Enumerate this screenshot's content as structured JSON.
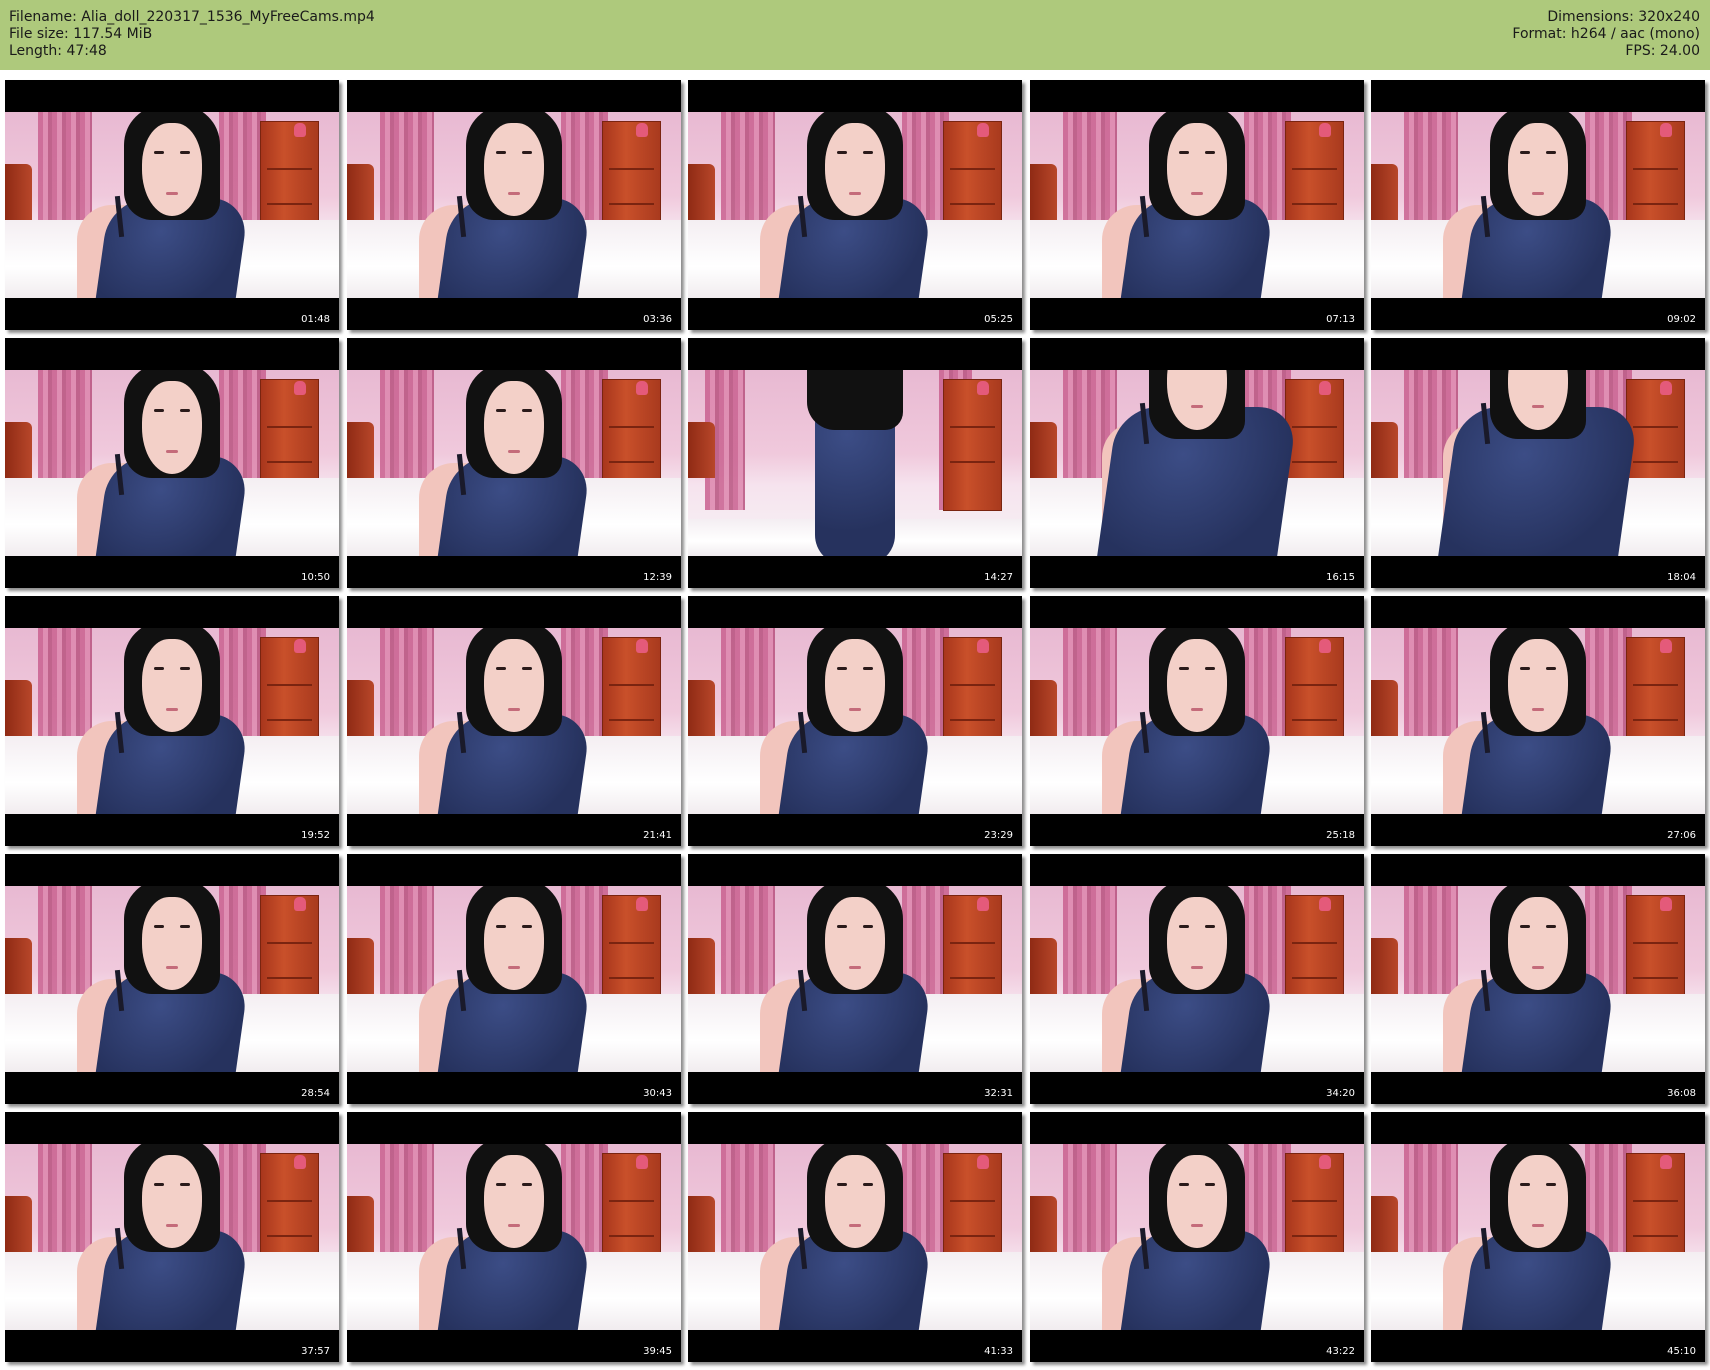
{
  "header": {
    "filename": "Filename: Alia_doll_220317_1536_MyFreeCams.mp4",
    "file_size": "File size: 117.54 MiB",
    "length": "Length: 47:48",
    "dimensions": "Dimensions: 320x240",
    "format": "Format: h264 / aac (mono)",
    "fps": "FPS: 24.00"
  },
  "colors": {
    "header_bg": "#aec97c",
    "thumb_bg": "#000000"
  },
  "thumbnails": [
    {
      "timestamp": "01:48",
      "variant": "normal"
    },
    {
      "timestamp": "03:36",
      "variant": "normal"
    },
    {
      "timestamp": "05:25",
      "variant": "normal"
    },
    {
      "timestamp": "07:13",
      "variant": "normal"
    },
    {
      "timestamp": "09:02",
      "variant": "normal"
    },
    {
      "timestamp": "10:50",
      "variant": "normal"
    },
    {
      "timestamp": "12:39",
      "variant": "normal"
    },
    {
      "timestamp": "14:27",
      "variant": "standing"
    },
    {
      "timestamp": "16:15",
      "variant": "close"
    },
    {
      "timestamp": "18:04",
      "variant": "close"
    },
    {
      "timestamp": "19:52",
      "variant": "normal"
    },
    {
      "timestamp": "21:41",
      "variant": "normal"
    },
    {
      "timestamp": "23:29",
      "variant": "normal"
    },
    {
      "timestamp": "25:18",
      "variant": "normal"
    },
    {
      "timestamp": "27:06",
      "variant": "normal"
    },
    {
      "timestamp": "28:54",
      "variant": "normal"
    },
    {
      "timestamp": "30:43",
      "variant": "normal"
    },
    {
      "timestamp": "32:31",
      "variant": "normal"
    },
    {
      "timestamp": "34:20",
      "variant": "normal"
    },
    {
      "timestamp": "36:08",
      "variant": "normal"
    },
    {
      "timestamp": "37:57",
      "variant": "normal"
    },
    {
      "timestamp": "39:45",
      "variant": "normal"
    },
    {
      "timestamp": "41:33",
      "variant": "normal"
    },
    {
      "timestamp": "43:22",
      "variant": "normal"
    },
    {
      "timestamp": "45:10",
      "variant": "normal"
    }
  ]
}
